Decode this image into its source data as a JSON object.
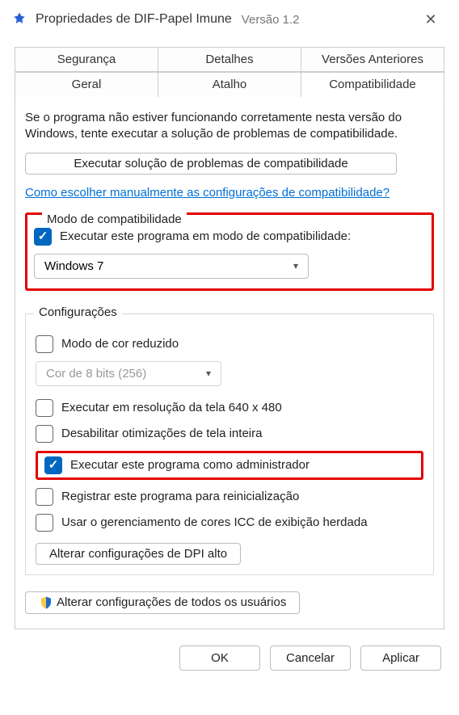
{
  "window": {
    "title": "Propriedades de DIF-Papel Imune",
    "version": "Versão 1.2"
  },
  "tabs": {
    "top": [
      "Segurança",
      "Detalhes",
      "Versões Anteriores"
    ],
    "bottom": [
      "Geral",
      "Atalho",
      "Compatibilidade"
    ],
    "active": "Compatibilidade"
  },
  "intro": "Se o programa não estiver funcionando corretamente nesta versão do Windows, tente executar a solução de problemas de compatibilidade.",
  "troubleshoot_btn": "Executar solução de problemas de compatibilidade",
  "help_link": "Como escolher manualmente as configurações de compatibilidade?",
  "compat_mode": {
    "legend": "Modo de compatibilidade",
    "chk_label": "Executar este programa em modo de compatibilidade:",
    "selected": "Windows 7"
  },
  "config": {
    "legend": "Configurações",
    "reduced_color": "Modo de cor reduzido",
    "color_depth": "Cor de 8 bits (256)",
    "resolution640": "Executar em resolução da tela 640 x 480",
    "disable_fullscreen": "Desabilitar otimizações de tela inteira",
    "run_admin": "Executar este programa como administrador",
    "register_restart": "Registrar este programa para reinicialização",
    "use_icc": "Usar o gerenciamento de cores ICC de exibição herdada",
    "dpi_btn": "Alterar configurações de DPI alto"
  },
  "all_users_btn": "Alterar configurações de todos os usuários",
  "footer": {
    "ok": "OK",
    "cancel": "Cancelar",
    "apply": "Aplicar"
  }
}
